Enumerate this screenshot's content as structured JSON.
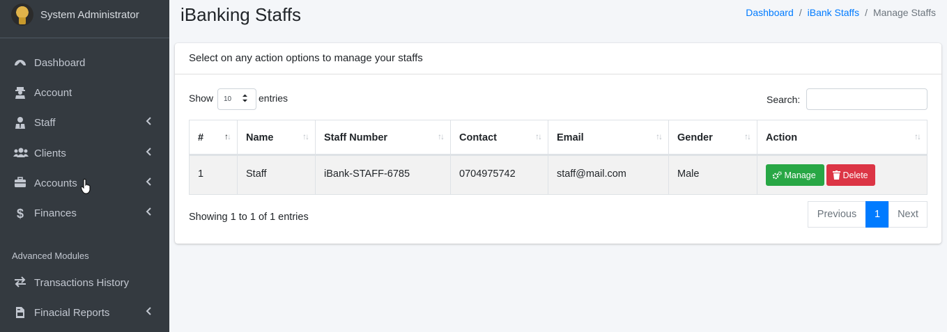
{
  "user": {
    "name": "System Administrator"
  },
  "sidebar": {
    "items": [
      {
        "label": "Dashboard",
        "icon": "dashboard-icon",
        "chevron": false
      },
      {
        "label": "Account",
        "icon": "user-secret-icon",
        "chevron": false
      },
      {
        "label": "Staff",
        "icon": "user-tie-icon",
        "chevron": true
      },
      {
        "label": "Clients",
        "icon": "users-icon",
        "chevron": true
      },
      {
        "label": "Accounts",
        "icon": "briefcase-icon",
        "chevron": true
      },
      {
        "label": "Finances",
        "icon": "dollar-icon",
        "chevron": true
      }
    ],
    "section_header": "Advanced Modules",
    "advanced_items": [
      {
        "label": "Transactions History",
        "icon": "exchange-icon",
        "chevron": false
      },
      {
        "label": "Finacial Reports",
        "icon": "file-invoice-icon",
        "chevron": true
      }
    ]
  },
  "page": {
    "title": "iBanking Staffs",
    "breadcrumb": [
      "Dashboard",
      "iBank Staffs",
      "Manage Staffs"
    ]
  },
  "card": {
    "title": "Select on any action options to manage your staffs",
    "length": {
      "show": "Show",
      "value": "10",
      "entries": "entries"
    },
    "search": {
      "label": "Search:",
      "value": ""
    },
    "table": {
      "columns": [
        "#",
        "Name",
        "Staff Number",
        "Contact",
        "Email",
        "Gender",
        "Action"
      ],
      "rows": [
        {
          "num": "1",
          "name": "Staff",
          "staff_number": "iBank-STAFF-6785",
          "contact": "0704975742",
          "email": "staff@mail.com",
          "gender": "Male"
        }
      ],
      "actions": {
        "manage": "Manage",
        "delete": "Delete"
      }
    },
    "info": "Showing 1 to 1 of 1 entries",
    "pagination": {
      "previous": "Previous",
      "current": "1",
      "next": "Next"
    }
  },
  "colors": {
    "sidebar_bg": "#343a40",
    "primary": "#007bff",
    "success": "#28a745",
    "danger": "#dc3545"
  }
}
